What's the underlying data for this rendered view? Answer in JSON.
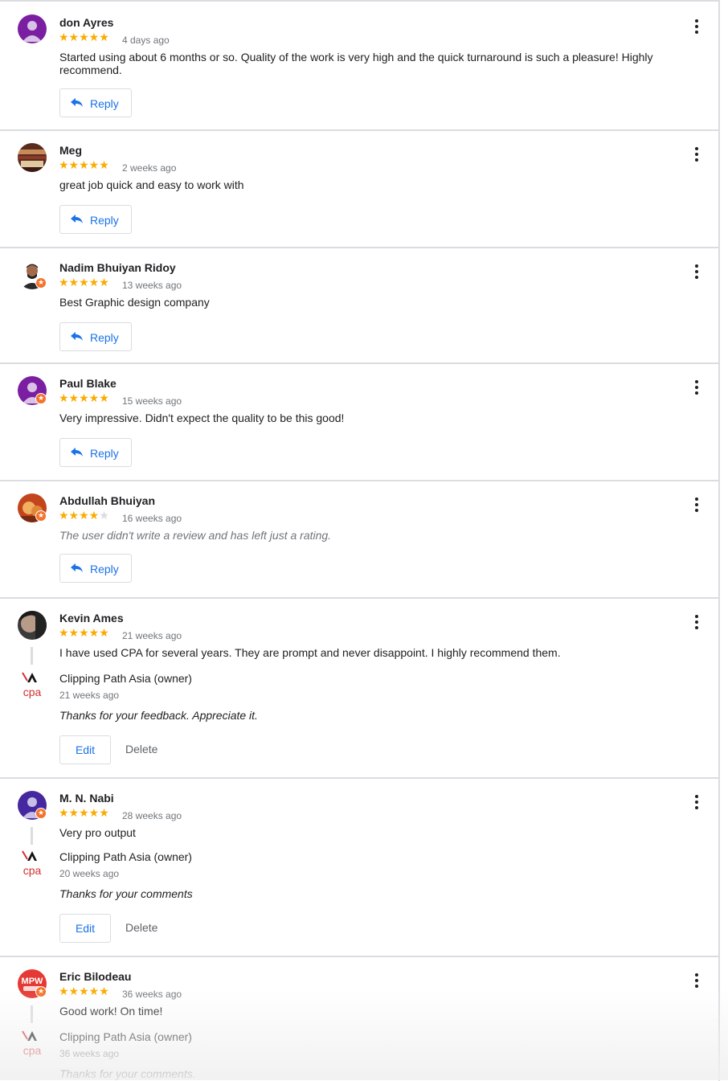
{
  "reviews": [
    {
      "name": "don Ayres",
      "stars": 5,
      "time": "4 days ago",
      "text": "Started using about 6 months or so. Quality of the work is very high and the quick turnaround is such a pleasure! Highly recommend.",
      "reply_label": "Reply"
    },
    {
      "name": "Meg",
      "stars": 5,
      "time": "2 weeks ago",
      "text": "great job quick and easy to work with",
      "reply_label": "Reply"
    },
    {
      "name": "Nadim Bhuiyan Ridoy",
      "stars": 5,
      "time": "13 weeks ago",
      "text": "Best Graphic design company",
      "reply_label": "Reply"
    },
    {
      "name": "Paul Blake",
      "stars": 5,
      "time": "15 weeks ago",
      "text": "Very impressive. Didn't expect the quality to be this good!",
      "reply_label": "Reply"
    },
    {
      "name": "Abdullah Bhuiyan",
      "stars": 4,
      "time": "16 weeks ago",
      "text": "The user didn't write a review and has left just a rating.",
      "reply_label": "Reply"
    },
    {
      "name": "Kevin Ames",
      "stars": 5,
      "time": "21 weeks ago",
      "text": "I have used CPA for several years. They are prompt and never disappoint. I highly recommend them.",
      "owner": {
        "name": "Clipping Path Asia (owner)",
        "time": "21 weeks ago",
        "text": "Thanks for your feedback. Appreciate it.",
        "edit_label": "Edit",
        "delete_label": "Delete"
      }
    },
    {
      "name": "M. N. Nabi",
      "stars": 5,
      "time": "28 weeks ago",
      "text": "Very pro output",
      "owner": {
        "name": "Clipping Path Asia (owner)",
        "time": "20 weeks ago",
        "text": "Thanks for your comments",
        "edit_label": "Edit",
        "delete_label": "Delete"
      }
    },
    {
      "name": "Eric Bilodeau",
      "stars": 5,
      "time": "36 weeks ago",
      "text": "Good work! On time!",
      "owner": {
        "name": "Clipping Path Asia (owner)",
        "time": "36 weeks ago",
        "text": "Thanks for your comments."
      }
    }
  ],
  "logo_text": "cpa",
  "mpw_text": "MPW"
}
